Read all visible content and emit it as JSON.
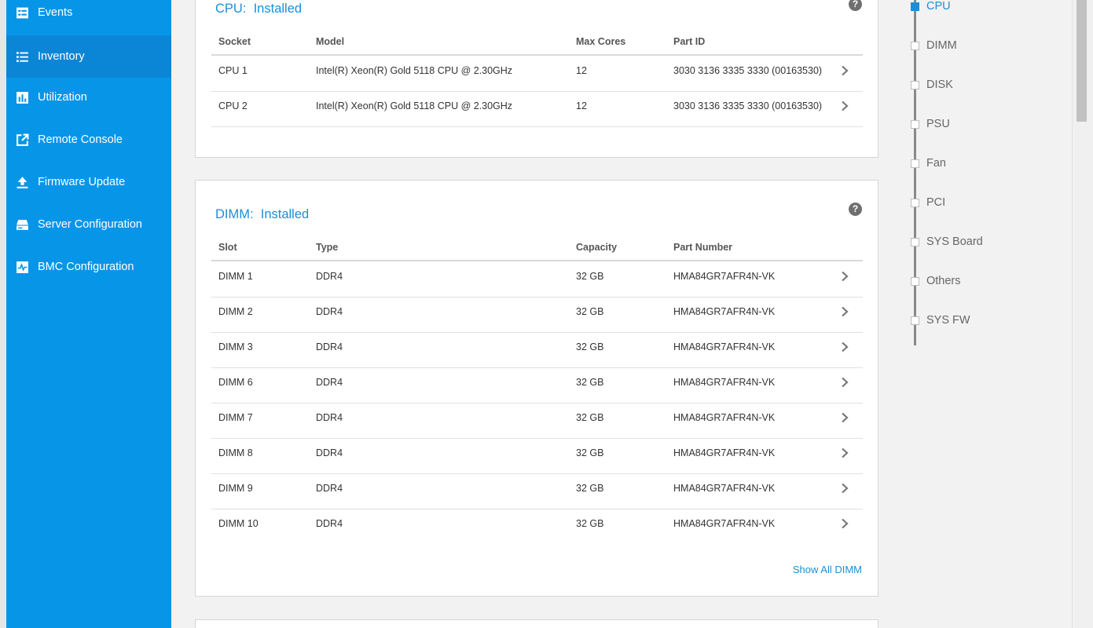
{
  "sidebar": {
    "items": [
      {
        "label": "Events",
        "icon": "events-icon"
      },
      {
        "label": "Inventory",
        "icon": "list-icon",
        "active": true
      },
      {
        "label": "Utilization",
        "icon": "bar-chart-icon"
      },
      {
        "label": "Remote Console",
        "icon": "external-link-icon"
      },
      {
        "label": "Firmware Update",
        "icon": "upload-icon"
      },
      {
        "label": "Server Configuration",
        "icon": "server-icon"
      },
      {
        "label": "BMC Configuration",
        "icon": "pulse-icon"
      }
    ]
  },
  "cpu": {
    "title_label": "CPU:",
    "title_status": "Installed",
    "help": "?",
    "columns": [
      "Socket",
      "Model",
      "Max Cores",
      "Part ID"
    ],
    "rows": [
      [
        "CPU 1",
        "Intel(R) Xeon(R) Gold 5118 CPU @ 2.30GHz",
        "12",
        "3030 3136 3335 3330 (00163530)"
      ],
      [
        "CPU 2",
        "Intel(R) Xeon(R) Gold 5118 CPU @ 2.30GHz",
        "12",
        "3030 3136 3335 3330 (00163530)"
      ]
    ]
  },
  "dimm": {
    "title_label": "DIMM:",
    "title_status": "Installed",
    "help": "?",
    "columns": [
      "Slot",
      "Type",
      "Capacity",
      "Part Number"
    ],
    "rows": [
      [
        "DIMM 1",
        "DDR4",
        "32 GB",
        "HMA84GR7AFR4N-VK"
      ],
      [
        "DIMM 2",
        "DDR4",
        "32 GB",
        "HMA84GR7AFR4N-VK"
      ],
      [
        "DIMM 3",
        "DDR4",
        "32 GB",
        "HMA84GR7AFR4N-VK"
      ],
      [
        "DIMM 6",
        "DDR4",
        "32 GB",
        "HMA84GR7AFR4N-VK"
      ],
      [
        "DIMM 7",
        "DDR4",
        "32 GB",
        "HMA84GR7AFR4N-VK"
      ],
      [
        "DIMM 8",
        "DDR4",
        "32 GB",
        "HMA84GR7AFR4N-VK"
      ],
      [
        "DIMM 9",
        "DDR4",
        "32 GB",
        "HMA84GR7AFR4N-VK"
      ],
      [
        "DIMM 10",
        "DDR4",
        "32 GB",
        "HMA84GR7AFR4N-VK"
      ]
    ],
    "show_all": "Show All DIMM"
  },
  "index": {
    "items": [
      {
        "label": "CPU",
        "active": true
      },
      {
        "label": "DIMM"
      },
      {
        "label": "DISK"
      },
      {
        "label": "PSU"
      },
      {
        "label": "Fan"
      },
      {
        "label": "PCI"
      },
      {
        "label": "SYS Board"
      },
      {
        "label": "Others"
      },
      {
        "label": "SYS FW"
      }
    ]
  },
  "colors": {
    "sidebar": "#0795e8",
    "sidebar_active": "#0b86d6",
    "accent": "#1b8fd6"
  }
}
